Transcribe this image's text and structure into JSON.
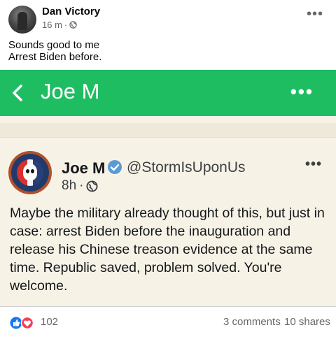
{
  "post": {
    "author": "Dan Victory",
    "time": "16 m",
    "text_line1": "Sounds good to me",
    "text_line2": "Arrest Biden before.",
    "more_icon": "more-horizontal-icon",
    "privacy_icon": "globe-icon"
  },
  "screenshot": {
    "app_bar_title": "Joe M",
    "app_bar_color": "#1fbd62",
    "background_color": "#f7f2e6",
    "tweet": {
      "name": "Joe M",
      "handle": "@StormIsUponUs",
      "time": "8h",
      "verified_color": "#5b9bd5",
      "body": "Maybe the military already thought of this, but just in case: arrest Biden before the inauguration and release his Chinese treason evidence at the same time. Republic saved, problem solved. You're welcome."
    }
  },
  "footer": {
    "reaction_count": "102",
    "comments": "3 comments",
    "shares": "10 shares"
  }
}
